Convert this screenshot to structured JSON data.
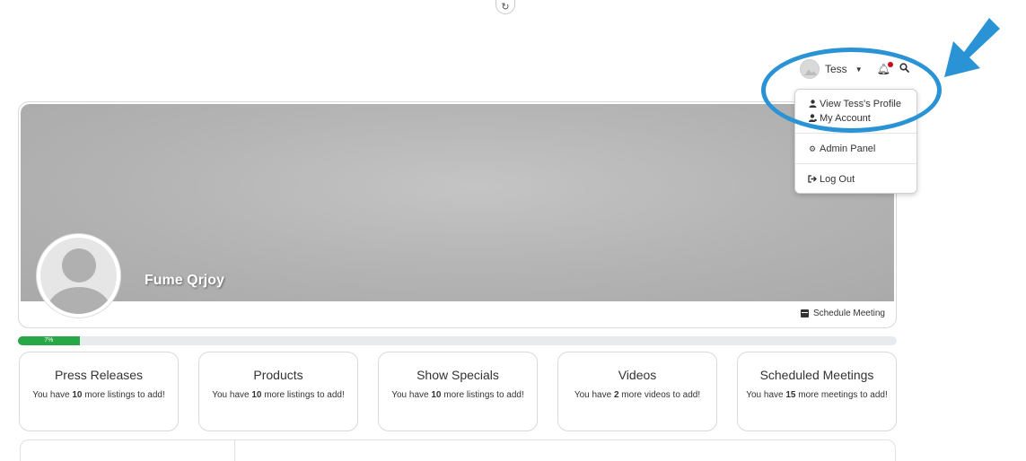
{
  "top": {
    "refresh_icon": "refresh-icon"
  },
  "user_bar": {
    "name": "Tess",
    "caret_icon": "caret-down-icon",
    "bell_icon": "bell-icon",
    "search_icon": "search-icon"
  },
  "dropdown": {
    "items": [
      {
        "label": "View Tess's Profile",
        "icon": "user-icon"
      },
      {
        "label": "My Account",
        "icon": "user-gear-icon"
      },
      {
        "label": "Admin Panel",
        "icon": "gear-icon"
      },
      {
        "label": "Log Out",
        "icon": "sign-out-icon"
      }
    ]
  },
  "profile": {
    "company_name": "Fume Qrjoy",
    "schedule_label": "Schedule Meeting"
  },
  "progress": {
    "percent": 7,
    "label": "7%"
  },
  "stats": [
    {
      "title": "Press Releases",
      "prefix": "You have ",
      "count": "10",
      "suffix": " more listings to add!"
    },
    {
      "title": "Products",
      "prefix": "You have ",
      "count": "10",
      "suffix": " more listings to add!"
    },
    {
      "title": "Show Specials",
      "prefix": "You have ",
      "count": "10",
      "suffix": " more listings to add!"
    },
    {
      "title": "Videos",
      "prefix": "You have ",
      "count": "2",
      "suffix": " more videos to add!"
    },
    {
      "title": "Scheduled Meetings",
      "prefix": "You have ",
      "count": "15",
      "suffix": " more meetings to add!"
    }
  ],
  "colors": {
    "highlight": "#2a93d5",
    "progress": "#27a745",
    "notification_dot": "#d0021b"
  }
}
